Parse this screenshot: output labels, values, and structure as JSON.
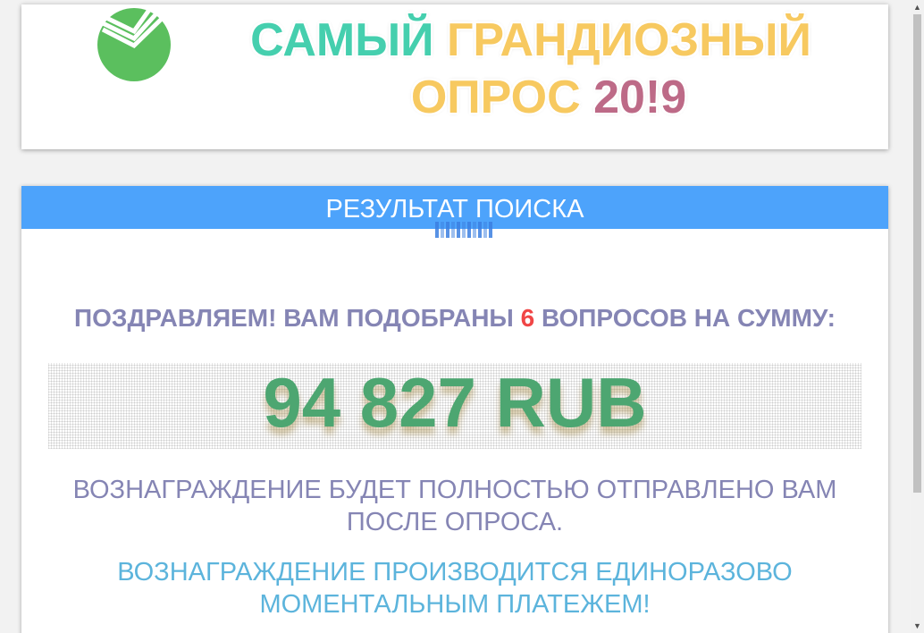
{
  "header": {
    "logo_icon": "sberbank-logo-icon",
    "title_word1": "САМЫЙ",
    "title_word2": "ГРАНДИОЗНЫЙ",
    "title_word3": "ОПРОС",
    "title_word4": "20!9"
  },
  "result": {
    "header_label": "РЕЗУЛЬТАТ ПОИСКА",
    "loader_icon": "loading-icon",
    "congrats_prefix": "ПОЗДРАВЛЯЕМ! ВАМ ПОДОБРАНЫ",
    "question_count": "6",
    "congrats_suffix": "ВОПРОСОВ НА СУММУ:",
    "amount": "94 827 RUB",
    "reward_line1": "ВОЗНАГРАЖДЕНИЕ БУДЕТ ПОЛНОСТЬЮ ОТПРАВЛЕНО ВАМ ПОСЛЕ ОПРОСА.",
    "reward_line2": "ВОЗНАГРАЖДЕНИЕ ПРОИЗВОДИТСЯ ЕДИНОРАЗОВО МОМЕНТАЛЬНЫМ ПЛАТЕЖЕМ!"
  },
  "scrollbar": {
    "up_icon": "scroll-up-arrow-icon",
    "down_icon": "scroll-down-arrow-icon",
    "up_glyph": "▲",
    "down_glyph": "▼"
  },
  "colors": {
    "header_bar": "#4da3fb",
    "amount": "#4da671",
    "highlight_number": "#f04646",
    "text_purple": "#8585b4",
    "text_blue": "#5cb4dc"
  }
}
